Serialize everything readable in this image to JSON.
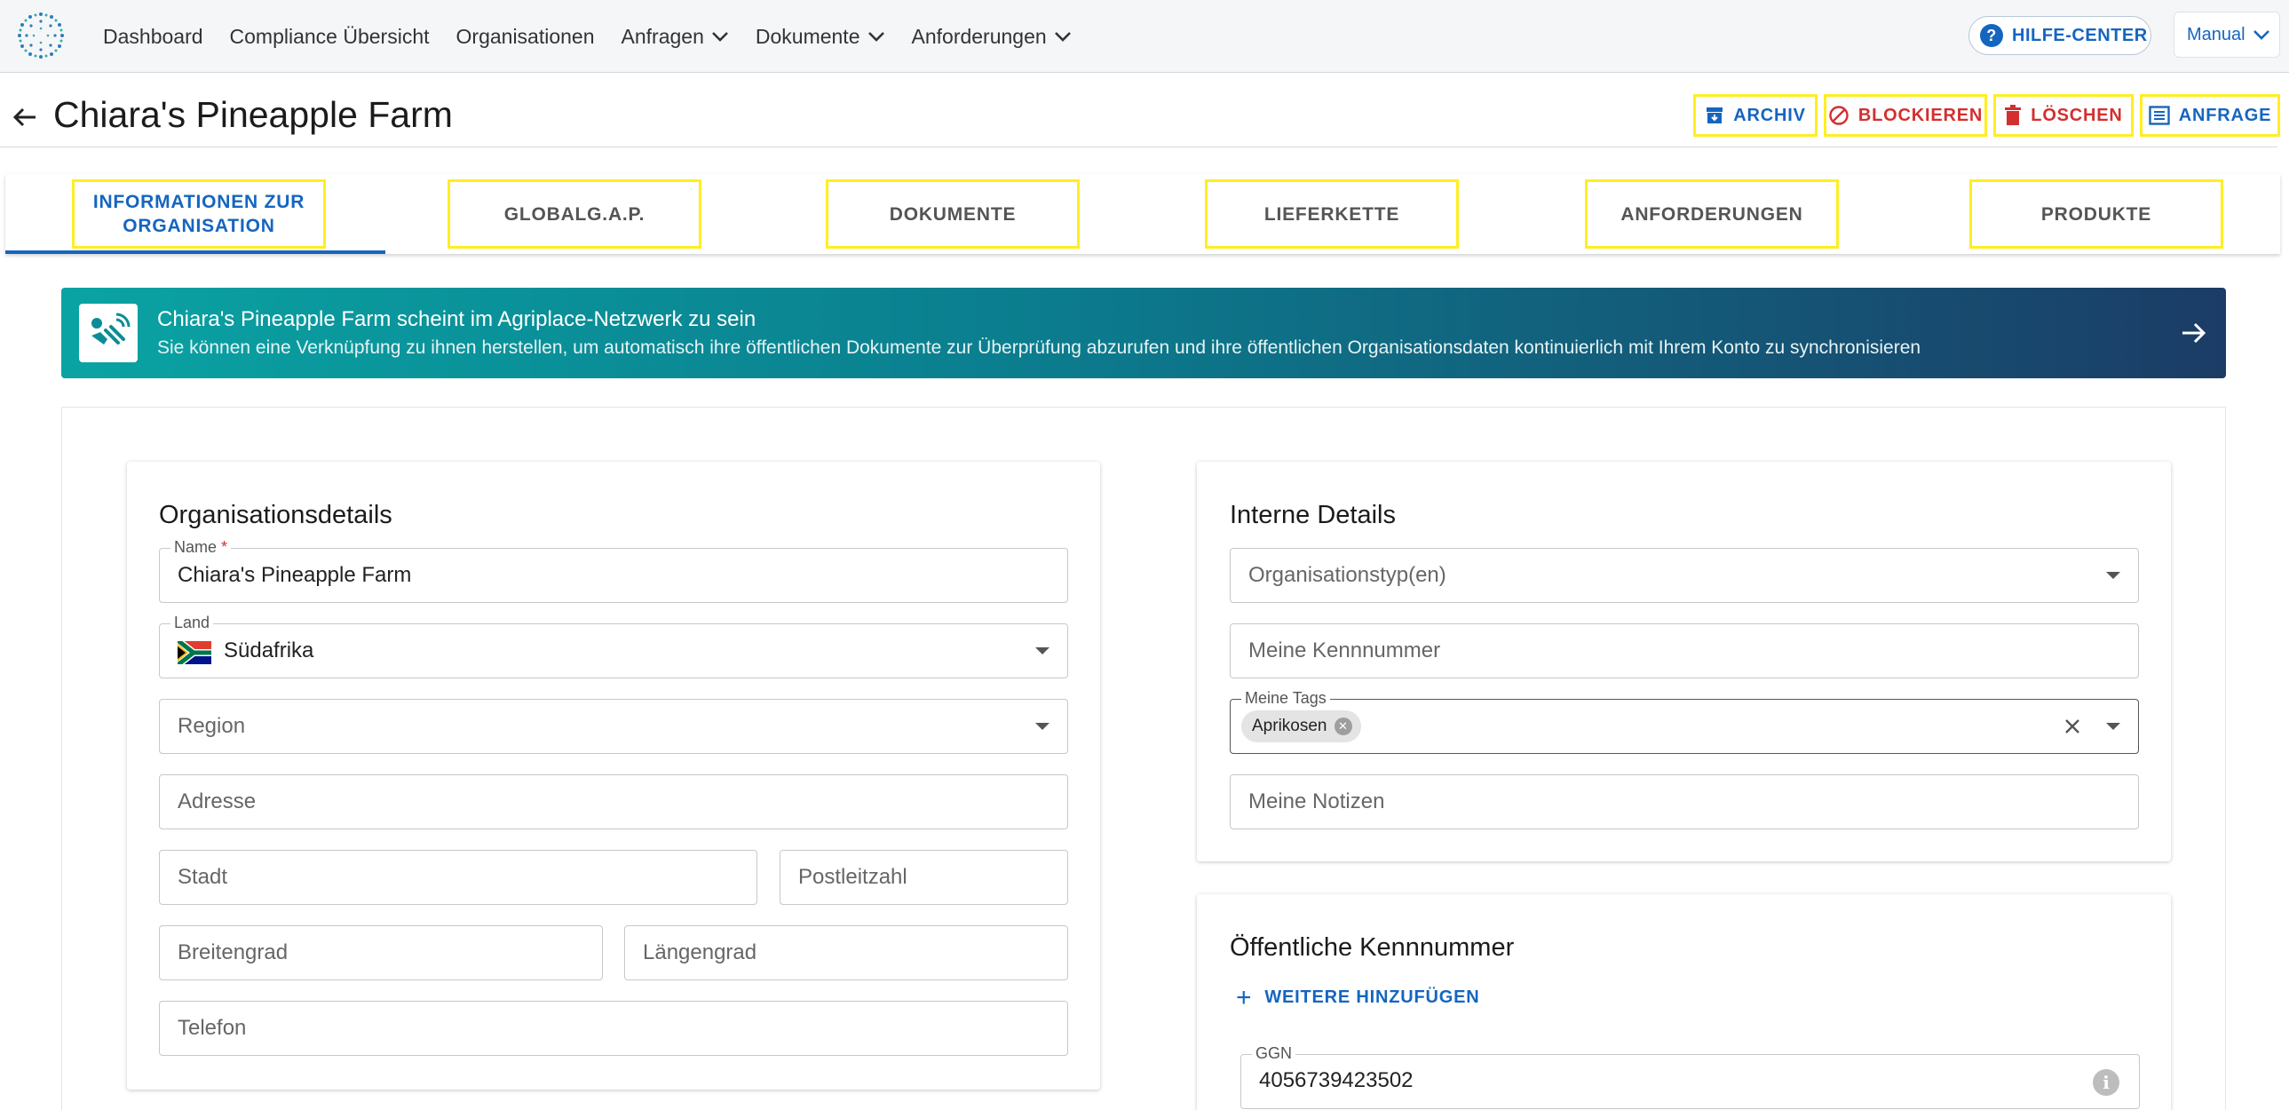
{
  "nav": {
    "items": [
      {
        "label": "Dashboard",
        "dropdown": false
      },
      {
        "label": "Compliance Übersicht",
        "dropdown": false
      },
      {
        "label": "Organisationen",
        "dropdown": false
      },
      {
        "label": "Anfragen",
        "dropdown": true
      },
      {
        "label": "Dokumente",
        "dropdown": true
      },
      {
        "label": "Anforderungen",
        "dropdown": true
      }
    ],
    "help_label": "HILFE-CENTER",
    "manual_label": "Manual"
  },
  "header": {
    "title": "Chiara's Pineapple Farm",
    "actions": {
      "archive": "ARCHIV",
      "block": "BLOCKIEREN",
      "delete": "LÖSCHEN",
      "request": "ANFRAGE"
    }
  },
  "tabs": [
    {
      "label": "INFORMATIONEN ZUR ORGANISATION",
      "line1": "INFORMATIONEN ZUR",
      "line2": "ORGANISATION",
      "active": true
    },
    {
      "label": "GLOBALG.A.P."
    },
    {
      "label": "DOKUMENTE"
    },
    {
      "label": "LIEFERKETTE"
    },
    {
      "label": "ANFORDERUNGEN"
    },
    {
      "label": "PRODUKTE"
    }
  ],
  "banner": {
    "title": "Chiara's Pineapple Farm scheint im Agriplace-Netzwerk zu sein",
    "subtitle": "Sie können eine Verknüpfung zu ihnen herstellen, um automatisch ihre öffentlichen Dokumente zur Überprüfung abzurufen und ihre öffentlichen Organisationsdaten kontinuierlich mit Ihrem Konto zu synchronisieren"
  },
  "org_details": {
    "title": "Organisationsdetails",
    "name_label": "Name",
    "name_required": "*",
    "name_value": "Chiara's Pineapple Farm",
    "country_label": "Land",
    "country_value": "Südafrika",
    "region_placeholder": "Region",
    "address_placeholder": "Adresse",
    "city_placeholder": "Stadt",
    "zip_placeholder": "Postleitzahl",
    "lat_placeholder": "Breitengrad",
    "lng_placeholder": "Längengrad",
    "phone_placeholder": "Telefon"
  },
  "internal_details": {
    "title": "Interne Details",
    "org_type_placeholder": "Organisationstyp(en)",
    "my_id_placeholder": "Meine Kennnummer",
    "tags_label": "Meine Tags",
    "tags": [
      "Aprikosen"
    ],
    "notes_placeholder": "Meine Notizen"
  },
  "public_id": {
    "title": "Öffentliche Kennnummer",
    "add_more_label": "WEITERE HINZUFÜGEN",
    "ggn_label": "GGN",
    "ggn_value": "4056739423502"
  },
  "colors": {
    "primary": "#1565c0",
    "danger": "#d32f2f",
    "highlight": "#ffee22",
    "banner_start": "#0aa3a3",
    "banner_end": "#1b3c66"
  }
}
